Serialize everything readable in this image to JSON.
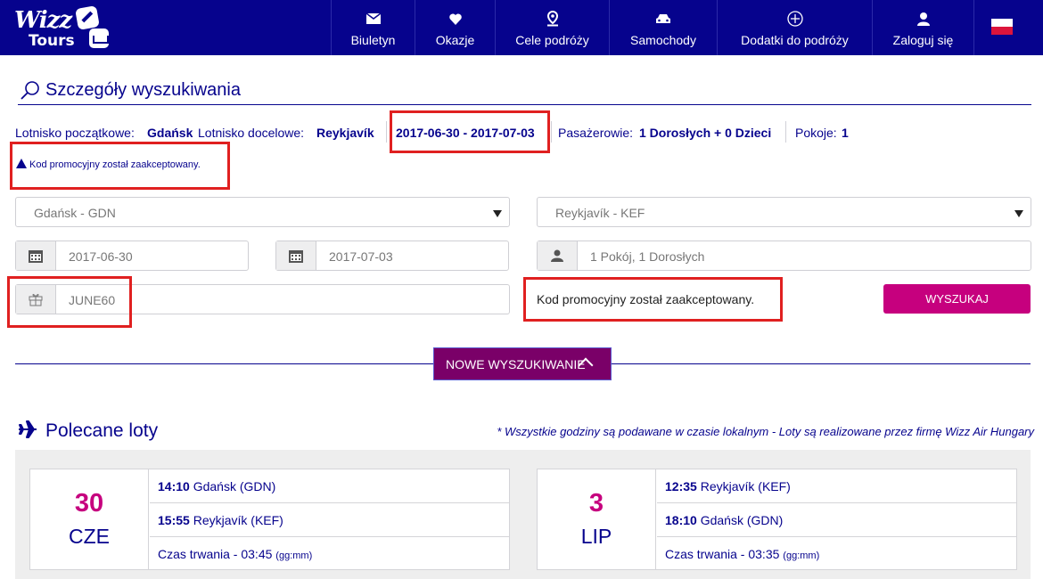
{
  "nav": {
    "logo_line1": "Wizz",
    "logo_line2": "Tours",
    "items": [
      {
        "label": "Biuletyn",
        "icon": "envelope-icon"
      },
      {
        "label": "Okazje",
        "icon": "heart-icon"
      },
      {
        "label": "Cele podróży",
        "icon": "map-pin-icon"
      },
      {
        "label": "Samochody",
        "icon": "car-icon"
      },
      {
        "label": "Dodatki do podróży",
        "icon": "plus-circle-icon"
      },
      {
        "label": "Zaloguj się",
        "icon": "user-icon"
      }
    ],
    "language_flag": "pl"
  },
  "search": {
    "title": "Szczegóły wyszukiwania",
    "origin_label": "Lotnisko początkowe:",
    "origin_value": "Gdańsk",
    "destination_label": "Lotnisko docelowe:",
    "destination_value": "Reykjavík",
    "dates_value": "2017-06-30 - 2017-07-03",
    "passengers_label": "Pasażerowie:",
    "passengers_value": "1 Dorosłych + 0 Dzieci",
    "rooms_label": "Pokoje:",
    "rooms_value": "1",
    "promo_notice": "Kod promocyjny został zaakceptowany.",
    "from_select": "Gdańsk - GDN",
    "to_select": "Reykjavík - KEF",
    "depart_date": "2017-06-30",
    "return_date": "2017-07-03",
    "rooms_guests": "1 Pokój, 1 Dorosłych",
    "promo_code": "JUNE60",
    "promo_status": "Kod promocyjny został zaakceptowany.",
    "search_button": "WYSZUKAJ",
    "new_search_button": "NOWE WYSZUKIWANIE"
  },
  "flights": {
    "title": "Polecane loty",
    "note": "* Wszystkie godziny są podawane w czasie lokalnym - Loty są realizowane przez firmę Wizz Air Hungary",
    "duration_label": "Czas trwania - ",
    "duration_unit": "(gg:mm)",
    "cards": [
      {
        "day": "30",
        "month": "CZE",
        "dep_time": "14:10",
        "dep_airport": "Gdańsk (GDN)",
        "arr_time": "15:55",
        "arr_airport": "Reykjavík (KEF)",
        "duration": "03:45"
      },
      {
        "day": "3",
        "month": "LIP",
        "dep_time": "12:35",
        "dep_airport": "Reykjavík (KEF)",
        "arr_time": "18:10",
        "arr_airport": "Gdańsk (GDN)",
        "duration": "03:35"
      }
    ]
  },
  "colors": {
    "brand_navy": "#06038d",
    "brand_magenta": "#c6007e",
    "new_search_purple": "#7a0068",
    "highlight_red": "#e02020"
  }
}
